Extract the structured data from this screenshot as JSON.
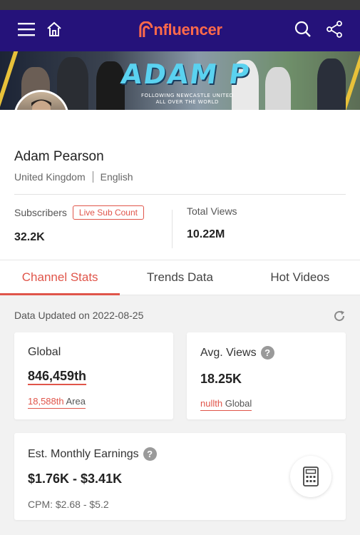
{
  "nav": {
    "logo_text": "nfluencer",
    "icons": [
      "menu-icon",
      "home-icon",
      "search-icon",
      "share-icon"
    ],
    "bg_color": "#25127a",
    "logo_color": "#ff6a4a"
  },
  "banner": {
    "title": "ADAM P",
    "subtitle_line1": "FOLLOWING NEWCASTLE UNITED",
    "subtitle_line2": "ALL OVER THE WORLD"
  },
  "profile": {
    "name": "Adam Pearson",
    "country": "United Kingdom",
    "language": "English",
    "social": [
      "youtube-icon",
      "instagram-icon"
    ]
  },
  "stats": {
    "subscribers_label": "Subscribers",
    "live_sub_label": "Live Sub Count",
    "subscribers_value": "32.2K",
    "views_label": "Total Views",
    "views_value": "10.22M"
  },
  "tabs": [
    {
      "label": "Channel Stats",
      "active": true
    },
    {
      "label": "Trends Data",
      "active": false
    },
    {
      "label": "Hot Videos",
      "active": false
    }
  ],
  "data_updated": "Data Updated on 2022-08-25",
  "cards": {
    "global": {
      "title": "Global",
      "value": "846,459th",
      "sub_rank": "18,588th",
      "sub_label": "Area"
    },
    "avg_views": {
      "title": "Avg. Views",
      "help": "?",
      "value": "18.25K",
      "sub_rank": "nullth",
      "sub_label": "Global"
    },
    "earnings": {
      "title": "Est. Monthly Earnings",
      "help": "?",
      "value": "$1.76K - $3.41K",
      "cpm": "CPM: $2.68 - $5.2"
    }
  },
  "colors": {
    "accent": "#e0554a",
    "background": "#f2f2f2"
  }
}
